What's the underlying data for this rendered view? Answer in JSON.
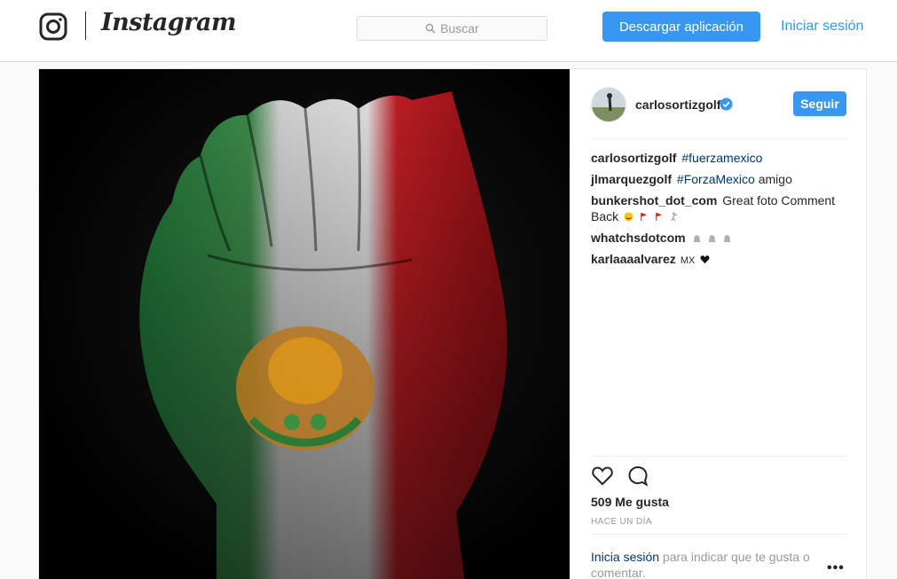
{
  "nav": {
    "brand": "Instagram",
    "search_placeholder": "Buscar",
    "download_label": "Descargar aplicación",
    "login_label": "Iniciar sesión"
  },
  "post": {
    "owner": "carlosortizgolf",
    "follow_label": "Seguir",
    "comments": [
      {
        "user": "carlosortizgolf",
        "text": "",
        "tag": "#fuerzamexico",
        "after": ""
      },
      {
        "user": "jlmarquezgolf",
        "text": "",
        "tag": "#ForzaMexico",
        "after": " amigo"
      },
      {
        "user": "bunkershot_dot_com",
        "text": " Great foto Comment Back",
        "tag": "",
        "after": ""
      },
      {
        "user": "whatchsdotcom",
        "text": "",
        "tag": "",
        "after": ""
      },
      {
        "user": "karlaaaalvarez",
        "text": " MX",
        "tag": "",
        "after": ""
      }
    ],
    "likes": "509 Me gusta",
    "time": "HACE UN DÍA",
    "login_link": "Inicia sesión",
    "login_rest": " para indicar que te gusta o comentar.",
    "more_label": "•••"
  },
  "icons": [
    "instagram-glyph-icon",
    "search-icon",
    "verified-badge-icon",
    "heart-icon",
    "comment-icon",
    "more-options-icon"
  ],
  "colors": {
    "accent": "#3897f0",
    "link": "#003569",
    "muted": "#999999"
  }
}
